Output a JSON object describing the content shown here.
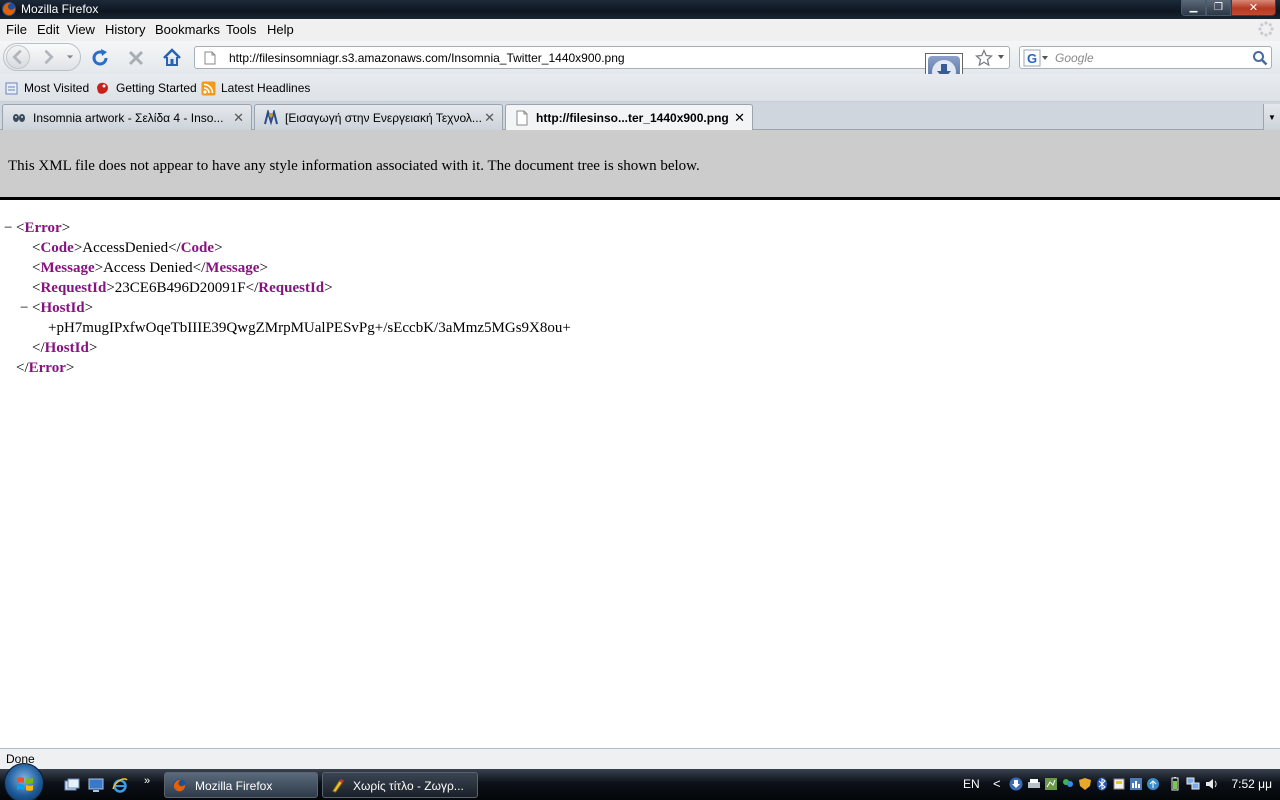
{
  "window": {
    "title": "Mozilla Firefox"
  },
  "menu": [
    "File",
    "Edit",
    "View",
    "History",
    "Bookmarks",
    "Tools",
    "Help"
  ],
  "navbar": {
    "url": "http://filesinsomniagr.s3.amazonaws.com/Insomnia_Twitter_1440x900.png",
    "search_placeholder": "Google"
  },
  "bookmarks": [
    "Most Visited",
    "Getting Started",
    "Latest Headlines"
  ],
  "tabs": [
    {
      "label": "Insomnia artwork - Σελίδα 4 - Inso...",
      "active": false
    },
    {
      "label": "[Εισαγωγή στην Ενεργειακή Τεχνολ...",
      "active": false
    },
    {
      "label": "http://filesinso...ter_1440x900.png",
      "active": true
    }
  ],
  "xml": {
    "banner": "This XML file does not appear to have any style information associated with it. The document tree is shown below.",
    "toggle": "−",
    "root_tag": "Error",
    "code_tag": "Code",
    "code_value": "AccessDenied",
    "message_tag": "Message",
    "message_value": "Access Denied",
    "requestid_tag": "RequestId",
    "requestid_value": "23CE6B496D20091F",
    "hostid_tag": "HostId",
    "hostid_value": "+pH7mugIPxfwOqeTbIIIE39QwgZMrpMUalPESvPg+/sEccbK/3aMmz5MGs9X8ou+"
  },
  "status": "Done",
  "taskbar": {
    "tasks": [
      {
        "label": "Mozilla Firefox",
        "active": true
      },
      {
        "label": "Χωρίς τίτλο - Ζωγρ...",
        "active": false
      }
    ],
    "quicklaunch_more": "»",
    "language": "EN",
    "tray_chevron": "<",
    "clock": "7:52 μμ"
  }
}
